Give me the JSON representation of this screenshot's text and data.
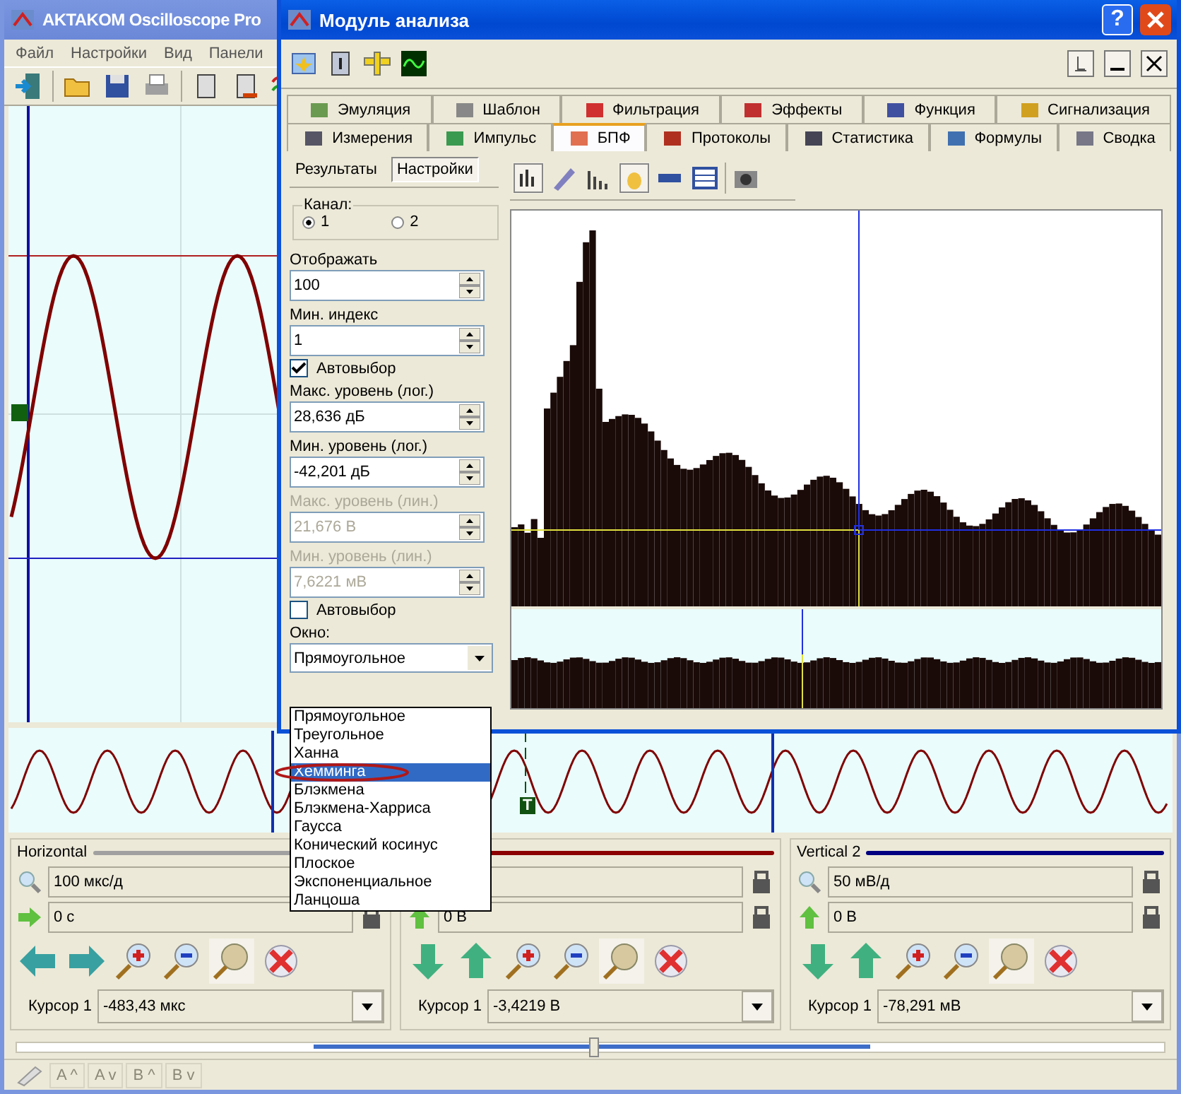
{
  "main_window": {
    "title": "AKTAKOM Oscilloscope Pro",
    "menu": [
      "Файл",
      "Настройки",
      "Вид",
      "Панели"
    ],
    "trigger_marker": "T"
  },
  "panels": [
    {
      "kind": "horizontal",
      "title": "Horizontal",
      "color": "#a0a0a0",
      "scale": "100 мкс/д",
      "offset": "0 с",
      "cursor_label": "Курсор 1",
      "cursor_value": "-483,43 мкс"
    },
    {
      "kind": "vertical",
      "color": "#8b0000",
      "offset": "0 В",
      "cursor_label": "Курсор 1",
      "cursor_value": "-3,4219 В"
    },
    {
      "kind": "vertical",
      "title": "Vertical 2",
      "color": "#000080",
      "scale": "50 мВ/д",
      "offset": "0 В",
      "cursor_label": "Курсор 1",
      "cursor_value": "-78,291 мВ"
    }
  ],
  "status_buttons": [
    {
      "label": "A ^",
      "disabled": true
    },
    {
      "label": "A v",
      "disabled": true
    },
    {
      "label": "B ^",
      "disabled": true
    },
    {
      "label": "B v",
      "disabled": true
    }
  ],
  "dialog": {
    "title": "Модуль анализа",
    "help_button": "?",
    "tab_rows": [
      [
        {
          "label": "Эмуляция",
          "selected": false
        },
        {
          "label": "Шаблон",
          "selected": false
        },
        {
          "label": "Фильтрация",
          "selected": false
        },
        {
          "label": "Эффекты",
          "selected": false
        },
        {
          "label": "Функция",
          "selected": false
        },
        {
          "label": "Сигнализация",
          "selected": false
        }
      ],
      [
        {
          "label": "Измерения",
          "selected": false
        },
        {
          "label": "Импульс",
          "selected": false
        },
        {
          "label": "БПФ",
          "selected": true
        },
        {
          "label": "Протоколы",
          "selected": false
        },
        {
          "label": "Статистика",
          "selected": false
        },
        {
          "label": "Формулы",
          "selected": false
        },
        {
          "label": "Сводка",
          "selected": false
        }
      ]
    ],
    "subtabs": [
      {
        "label": "Результаты",
        "selected": false
      },
      {
        "label": "Настройки",
        "selected": true
      }
    ],
    "channel": {
      "label": "Канал:",
      "options": [
        {
          "label": "1",
          "selected": true
        },
        {
          "label": "2",
          "selected": false
        }
      ]
    },
    "settings": [
      {
        "kind": "spin",
        "label": "Отображать",
        "value": "100",
        "disabled": false
      },
      {
        "kind": "spin",
        "label": "Мин. индекс",
        "value": "1",
        "disabled": false
      },
      {
        "kind": "checkbox",
        "label": "Автовыбор",
        "checked": true
      },
      {
        "kind": "spin",
        "label": "Макс. уровень (лог.)",
        "value": "28,636 дБ",
        "disabled": false
      },
      {
        "kind": "spin",
        "label": "Мин. уровень (лог.)",
        "value": "-42,201 дБ",
        "disabled": false
      },
      {
        "kind": "spin",
        "label": "Макс. уровень (лин.)",
        "value": "21,676 В",
        "disabled": true
      },
      {
        "kind": "spin",
        "label": "Мин. уровень (лин.)",
        "value": "7,6221 мВ",
        "disabled": true
      },
      {
        "kind": "checkbox",
        "label": "Автовыбор",
        "checked": false
      },
      {
        "kind": "select",
        "label": "Окно:",
        "value": "Прямоугольное"
      }
    ],
    "window_list": [
      {
        "label": "Прямоугольное",
        "selected": false,
        "circled": false
      },
      {
        "label": "Треугольное",
        "selected": false,
        "circled": false
      },
      {
        "label": "Ханна",
        "selected": false,
        "circled": false
      },
      {
        "label": "Хемминга",
        "selected": true,
        "circled": true
      },
      {
        "label": "Блэкмена",
        "selected": false,
        "circled": false
      },
      {
        "label": "Блэкмена-Харриса",
        "selected": false,
        "circled": false
      },
      {
        "label": "Гаусса",
        "selected": false,
        "circled": false
      },
      {
        "label": "Конический косинус",
        "selected": false,
        "circled": false
      },
      {
        "label": "Плоское",
        "selected": false,
        "circled": false
      },
      {
        "label": "Экспоненциальное",
        "selected": false,
        "circled": false
      },
      {
        "label": "Ланцоша",
        "selected": false,
        "circled": false
      }
    ]
  }
}
